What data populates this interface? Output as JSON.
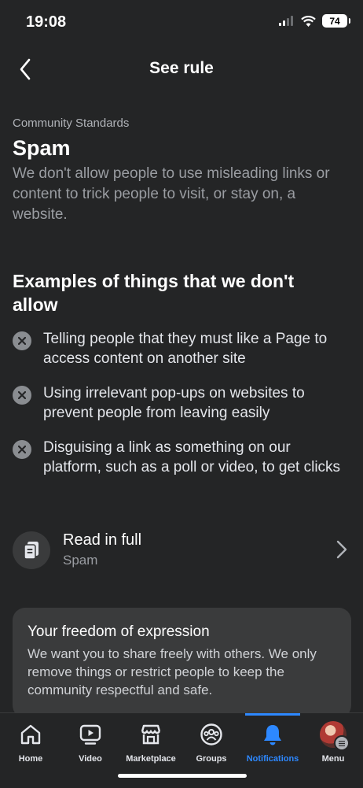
{
  "status_bar": {
    "time": "19:08",
    "battery": "74"
  },
  "header": {
    "title": "See rule"
  },
  "rule": {
    "eyebrow": "Community Standards",
    "title": "Spam",
    "description": "We don't allow people to use misleading links or content to trick people to visit, or stay on, a website."
  },
  "examples": {
    "title": "Examples of things that we don't allow",
    "items": [
      "Telling people that they must like a Page to access content on another site",
      "Using irrelevant pop-ups on websites to prevent people from leaving easily",
      "Disguising a link as something on our platform, such as a poll or video, to get clicks"
    ]
  },
  "read_full": {
    "title": "Read in full",
    "subtitle": "Spam"
  },
  "freedom": {
    "title": "Your freedom of expression",
    "text": "We want you to share freely with others. We only remove things or restrict people to keep the community respectful and safe."
  },
  "tab_bar": {
    "tabs": [
      {
        "label": "Home",
        "icon": "home-icon"
      },
      {
        "label": "Video",
        "icon": "video-icon"
      },
      {
        "label": "Marketplace",
        "icon": "marketplace-icon"
      },
      {
        "label": "Groups",
        "icon": "groups-icon"
      },
      {
        "label": "Notifications",
        "icon": "bell-icon",
        "active": true
      },
      {
        "label": "Menu",
        "icon": "avatar"
      }
    ],
    "active_color": "#2d88ff"
  }
}
